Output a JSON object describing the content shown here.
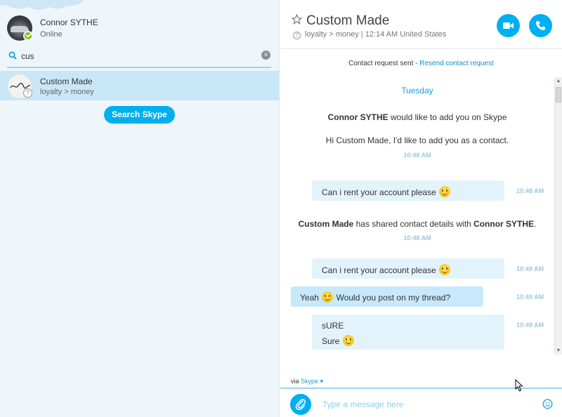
{
  "profile": {
    "name": "Connor SYTHE",
    "status": "Online"
  },
  "search": {
    "value": "cus",
    "clear_icon": "×"
  },
  "results": [
    {
      "name": "Custom Made",
      "mood": "loyalty > money"
    }
  ],
  "search_skype_label": "Search Skype",
  "chat": {
    "title": "Custom Made",
    "subtitle": "loyalty > money | 12:14 AM United States",
    "contact_request_text": "Contact request sent - ",
    "resend_label": "Resend contact request"
  },
  "messages": {
    "day": "Tuesday",
    "sys1_name": "Connor SYTHE",
    "sys1_text": " would like to add you on Skype",
    "sys1_note": "Hi Custom Made, I'd like to add you as a contact.",
    "sys1_time": "10:48 AM",
    "msg1_text": "Can i rent your account please ",
    "msg1_time": "10:48 AM",
    "sys2_name": "Custom Made",
    "sys2_text": " has shared contact details with ",
    "sys2_name2": "Connor SYTHE",
    "sys2_end": ".",
    "sys2_time": "10:48 AM",
    "msg2_text": "Can i rent your account please ",
    "msg2_time": "10:49 AM",
    "msg3_pre": "Yeah ",
    "msg3_post": " Would you post on my thread?",
    "msg3_time": "10:49 AM",
    "msg4_line1": "sURE",
    "msg4_line2": "Sure ",
    "msg4_time": "10:49 AM"
  },
  "compose": {
    "via": "via ",
    "via_app": "Skype ▾",
    "placeholder": "Type a message here"
  },
  "colors": {
    "accent": "#00aff0",
    "bubble": "#e3f3fc",
    "selected": "#c9e7f7"
  }
}
